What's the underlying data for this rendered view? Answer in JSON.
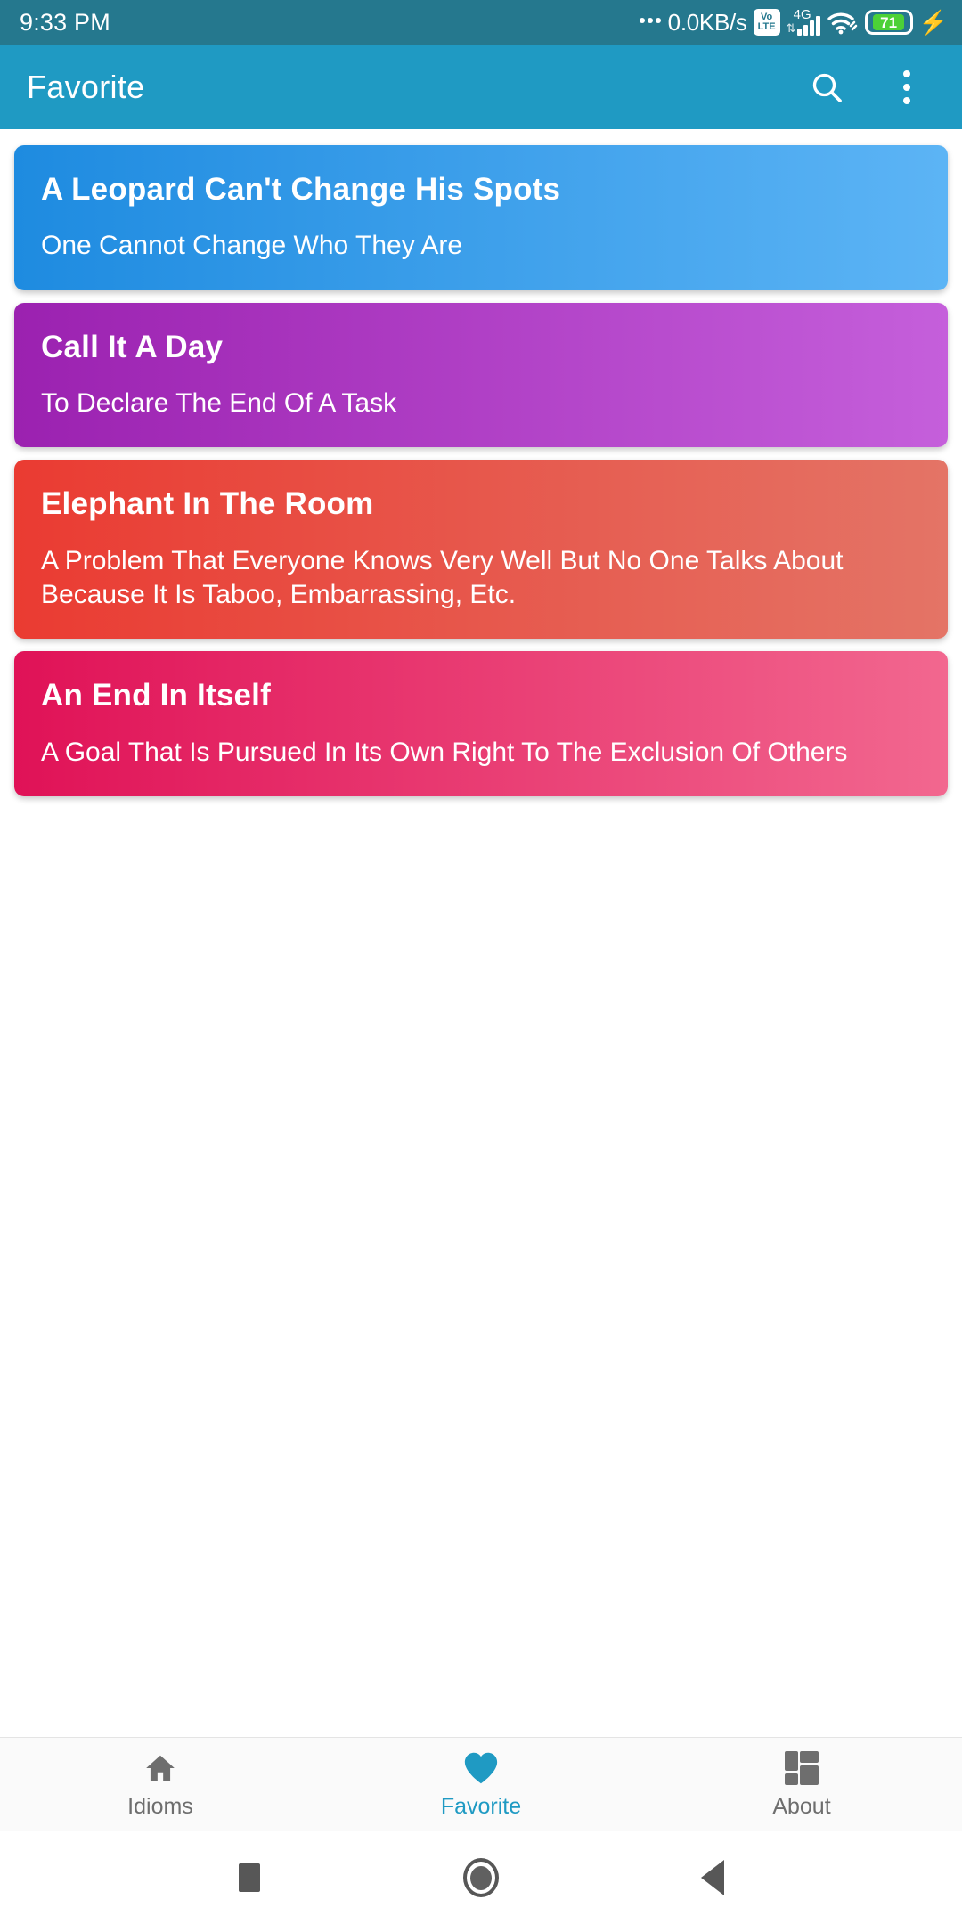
{
  "status_bar": {
    "time": "9:33 PM",
    "network_speed": "0.0KB/s",
    "volte_top": "Vo",
    "volte_bottom": "LTE",
    "network_type": "4G",
    "battery_percent": "71",
    "icons": [
      "speed-dots-icon",
      "volte-icon",
      "signal-bars-icon",
      "wifi-icon",
      "battery-icon",
      "charging-bolt-icon"
    ],
    "background_color": "#25788E"
  },
  "app_bar": {
    "title": "Favorite",
    "search_icon": "search-icon",
    "overflow_icon": "more-vertical-icon",
    "background_color": "#1F9AC3"
  },
  "cards": [
    {
      "title": "A Leopard Can't Change His Spots",
      "subtitle": "One Cannot Change Who They Are",
      "gradient_from": "#1E8BE0",
      "gradient_to": "#5CB4F5"
    },
    {
      "title": "Call It A Day",
      "subtitle": "To Declare The End Of A Task",
      "gradient_from": "#9B21B0",
      "gradient_to": "#C55FDB"
    },
    {
      "title": "Elephant In The Room",
      "subtitle": "A Problem That Everyone Knows Very Well But No One Talks About Because It Is Taboo, Embarrassing, Etc.",
      "gradient_from": "#EA3B32",
      "gradient_to": "#E47466"
    },
    {
      "title": "An End In Itself",
      "subtitle": "A Goal That Is Pursued In Its Own Right To The Exclusion Of Others",
      "gradient_from": "#E01257",
      "gradient_to": "#F2678F"
    }
  ],
  "bottom_nav": {
    "active_color": "#1F9AC3",
    "inactive_color": "#6E6E6E",
    "items": [
      {
        "label": "Idioms",
        "icon": "home-icon",
        "active": false
      },
      {
        "label": "Favorite",
        "icon": "heart-icon",
        "active": true
      },
      {
        "label": "About",
        "icon": "dashboard-icon",
        "active": false
      }
    ]
  },
  "system_nav": {
    "recents": "square-icon",
    "home": "circle-icon",
    "back": "triangle-back-icon"
  }
}
